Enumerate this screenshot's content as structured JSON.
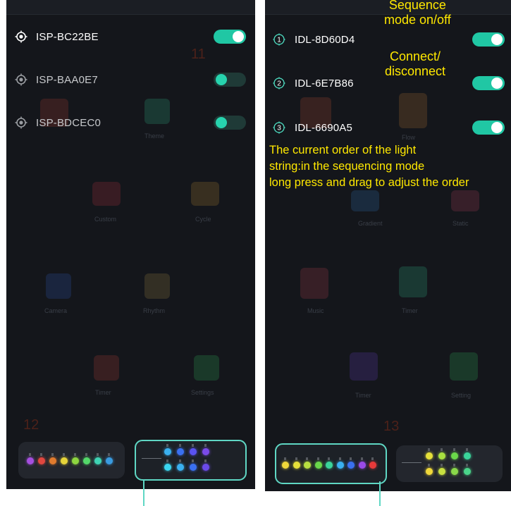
{
  "left_panel": {
    "devices": [
      {
        "name": "ISP-BC22BE",
        "enabled": true,
        "name_color": "#ffffff"
      },
      {
        "name": "ISP-BAA0E7",
        "enabled": false,
        "name_color": "#c7c9cc"
      },
      {
        "name": "ISP-BDCEC0",
        "enabled": false,
        "name_color": "#c7c9cc"
      }
    ],
    "bg_numbers": [
      "11",
      "12"
    ],
    "bg_labels": [
      "Theme",
      "Custom",
      "Cycle",
      "Camera",
      "Rhythm",
      "Timer",
      "Settings"
    ],
    "card_plain_dots": [
      "#a64fe0",
      "#e0473f",
      "#e07b2e",
      "#e6d43a",
      "#8ed640",
      "#54d86a",
      "#3fd4b4",
      "#3a9be0"
    ],
    "card_selected_dots_top": [
      "#3ab0f0",
      "#3a70f0",
      "#5a52f0",
      "#7a4ae8"
    ],
    "card_selected_dots_bottom": [
      "#3ad6f0",
      "#3ab0f0",
      "#3a70f0",
      "#6a4ae8"
    ]
  },
  "right_panel": {
    "devices": [
      {
        "index": "1",
        "name": "IDL-8D60D4",
        "enabled": true
      },
      {
        "index": "2",
        "name": "IDL-6E7B86",
        "enabled": true
      },
      {
        "index": "3",
        "name": "IDL-6690A5",
        "enabled": true
      }
    ],
    "annotations": {
      "sequence": "Sequence\nmode on/off",
      "connect": "Connect/\ndisconnect",
      "order": "The current order of the light\nstring:in the sequencing mode\nlong press and drag to adjust the order"
    },
    "bg_numbers": [
      "13"
    ],
    "bg_labels": [
      "Flow",
      "Gradient",
      "Static",
      "Music",
      "Timer",
      "Setting"
    ],
    "card_selected_dots": [
      "#f0d83a",
      "#e6e03a",
      "#b8e040",
      "#6ad84a",
      "#3ad49a",
      "#3ab0f0",
      "#3a70f0",
      "#9a4ae8",
      "#e83a3a"
    ],
    "card_plain_dots_top": [
      "#e6e03a",
      "#a8e040",
      "#6ad84a",
      "#3ad49a"
    ],
    "card_plain_dots_bottom": [
      "#f0d83a",
      "#c8e040",
      "#8ad84a",
      "#4ad48a"
    ]
  },
  "colors": {
    "accent": "#20c7a4",
    "annotation": "#ffe800",
    "panel_bg": "#14161b"
  },
  "icons": {
    "target": "target-icon",
    "numbered": "numbered-circle-icon"
  }
}
